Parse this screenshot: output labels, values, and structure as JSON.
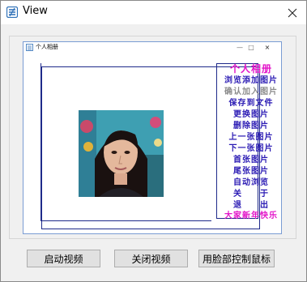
{
  "window": {
    "title": "View"
  },
  "viewer": {
    "title": "个人相册",
    "menu_header": "个人相册",
    "menu_items": [
      {
        "label": "浏览添加图片",
        "disabled": false
      },
      {
        "label": "确认加入图片",
        "disabled": true
      },
      {
        "label": "保存到文件",
        "disabled": false
      },
      {
        "label": "更换图片",
        "disabled": false
      },
      {
        "label": "删除图片",
        "disabled": false
      },
      {
        "label": "上一张图片",
        "disabled": false
      },
      {
        "label": "下一张图片",
        "disabled": false
      },
      {
        "label": "首张图片",
        "disabled": false
      },
      {
        "label": "尾张图片",
        "disabled": false
      },
      {
        "label": "自动浏览",
        "disabled": false
      },
      {
        "label": "关　　于",
        "disabled": false
      },
      {
        "label": "退　　出",
        "disabled": false
      }
    ],
    "menu_footer": "大家新年快乐",
    "controls": {
      "minimize": "—",
      "maximize": "□",
      "close": "×"
    }
  },
  "buttons": {
    "start_video": "启动视频",
    "stop_video": "关闭视频",
    "face_mouse": "用脸部控制鼠标"
  },
  "colors": {
    "menu_item": "#2b1bb4",
    "menu_header": "#e316c9",
    "frame": "#1f2a8a"
  }
}
